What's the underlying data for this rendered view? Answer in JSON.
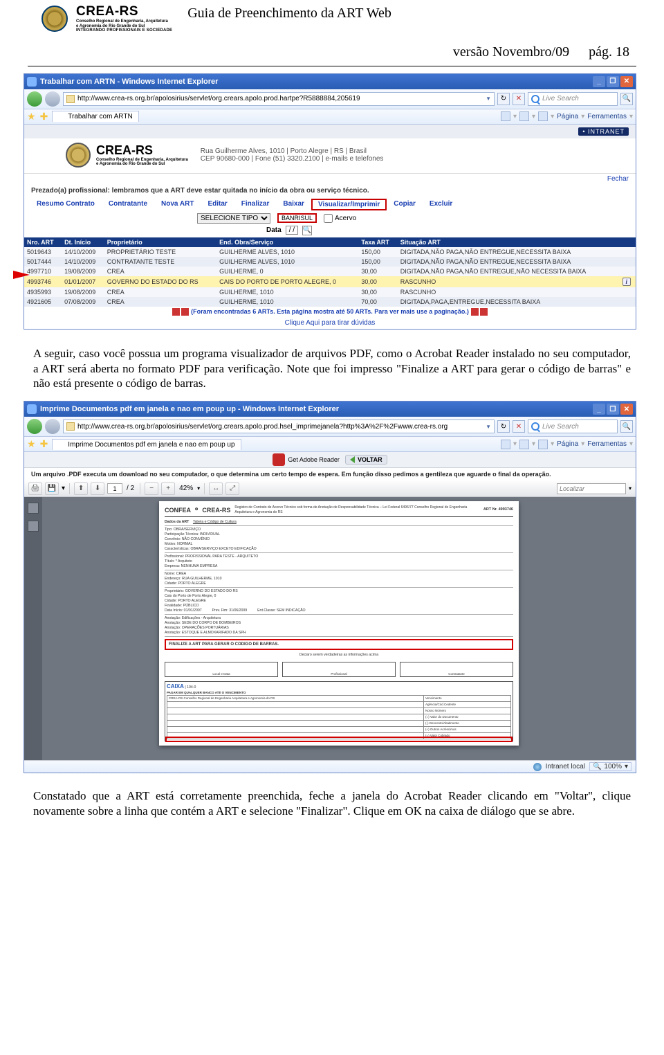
{
  "header": {
    "logo_main": "CREA-RS",
    "logo_sub1": "Conselho Regional de Engenharia, Arquitetura",
    "logo_sub2": "e Agronomia do Rio Grande do Sul",
    "logo_sub3": "INTEGRANDO PROFISSIONAIS E SOCIEDADE",
    "title": "Guia de Preenchimento da ART Web",
    "version": "versão Novembro/09",
    "page": "pág. 18"
  },
  "ie1": {
    "title": "Trabalhar com ARTN - Windows Internet Explorer",
    "url": "http://www.crea-rs.org.br/apolosirius/servlet/org.crears.apolo.prod.hartpe?R5888884,205619",
    "search_placeholder": "Live Search",
    "tab_label": "Trabalhar com ARTN",
    "toolbar_pagina": "Página",
    "toolbar_ferramentas": "Ferramentas",
    "btn_min": "_",
    "btn_max": "❐",
    "btn_close": "✕"
  },
  "app": {
    "intranet": "• INTRANET",
    "logo": "CREA-RS",
    "logo_sub": "Conselho Regional de Engenharia, Arquitetura\ne Agronomia do Rio Grande do Sul",
    "address1": "Rua Guilherme Alves, 1010 | Porto Alegre | RS | Brasil",
    "address2": "CEP 90680-000 | Fone (51) 3320.2100 | e-mails e telefones",
    "fechar": "Fechar",
    "notice": "Prezado(a) profissional: lembramos que a ART deve estar quitada no início da obra ou serviço técnico.",
    "menu": [
      "Resumo Contrato",
      "Contratante",
      "Nova ART",
      "Editar",
      "Finalizar",
      "Baixar",
      "Visualizar/Imprimir",
      "Copiar",
      "Excluir"
    ],
    "highlight_menu_index": 6,
    "filter_select": "SELECIONE TIPO",
    "filter_bank": "BANRISUL",
    "filter_acervo": "Acervo",
    "filter_data_label": "Data",
    "filter_date": "/  /",
    "columns": [
      "Nro. ART",
      "Dt. Início",
      "Proprietário",
      "End. Obra/Serviço",
      "Taxa ART",
      "Situação ART"
    ],
    "rows": [
      {
        "nro": "5019643",
        "dt": "14/10/2009",
        "prop": "PROPRIETÁRIO TESTE",
        "end": "GUILHERME ALVES, 1010",
        "taxa": "150,00",
        "sit": "DIGITADA,NÃO PAGA,NÃO ENTREGUE,NECESSITA BAIXA"
      },
      {
        "nro": "5017444",
        "dt": "14/10/2009",
        "prop": "CONTRATANTE TESTE",
        "end": "GUILHERME ALVES, 1010",
        "taxa": "150,00",
        "sit": "DIGITADA,NÃO PAGA,NÃO ENTREGUE,NECESSITA BAIXA"
      },
      {
        "nro": "4997710",
        "dt": "19/08/2009",
        "prop": "CREA",
        "end": "GUILHERME, 0",
        "taxa": "30,00",
        "sit": "DIGITADA,NÃO PAGA,NÃO ENTREGUE,NÃO NECESSITA BAIXA"
      },
      {
        "nro": "4993746",
        "dt": "01/01/2007",
        "prop": "GOVERNO DO ESTADO DO RS",
        "end": "CAIS DO PORTO DE PORTO ALEGRE, 0",
        "taxa": "30,00",
        "sit": "RASCUNHO"
      },
      {
        "nro": "4935993",
        "dt": "19/08/2009",
        "prop": "CREA",
        "end": "GUILHERME, 1010",
        "taxa": "30,00",
        "sit": "RASCUNHO"
      },
      {
        "nro": "4921605",
        "dt": "07/08/2009",
        "prop": "CREA",
        "end": "GUILHERME, 1010",
        "taxa": "70,00",
        "sit": "DIGITADA,PAGA,ENTREGUE,NECESSITA BAIXA"
      }
    ],
    "highlight_row_index": 3,
    "pagination_note": "(Foram encontradas   6 ARTs. Esta página mostra até 50 ARTs. Para ver mais use a paginação.)",
    "help": "Clique Aqui para tirar dúvidas"
  },
  "para1": "A seguir, caso você possua um programa visualizador de arquivos PDF, como o Acrobat Reader instalado no seu computador, a ART será aberta no formato PDF para verificação. Note que foi impresso \"Finalize a ART para gerar o código de barras\" e não está presente o código de barras.",
  "ie2": {
    "title": "Imprime Documentos pdf em janela e nao em poup up - Windows Internet Explorer",
    "url": "http://www.crea-rs.org.br/apolosirius/servlet/org.crears.apolo.prod.hsel_imprimejanela?http%3A%2F%2Fwww.crea-rs.org",
    "search_placeholder": "Live Search",
    "tab_label": "Imprime Documentos pdf em janela e nao em poup up",
    "toolbar_pagina": "Página",
    "toolbar_ferramentas": "Ferramentas",
    "getreader": "Get Adobe Reader",
    "voltar": "VOLTAR",
    "notice": "Um arquivo .PDF executa um download no seu computador, o que determina um certo tempo de espera. Em função disso pedimos a gentileza que aguarde o final da operação.",
    "page_current": "1",
    "page_total": "/ 2",
    "zoom": "42%",
    "find_placeholder": "Localizar",
    "status_zone": "Intranet local",
    "status_zoom": "100%"
  },
  "pdfdoc": {
    "confea": "CONFEA",
    "crears": "CREA-RS",
    "hdr_desc": "Registro de Contrato de Acervo Técnico sob forma de Anotação de Responsabilidade Técnica – Lei Federal 6496/77 Conselho Regional de Engenharia Arquitetura e Agronomia do RS",
    "artno_label": "ART Nr.",
    "artno": "4993746",
    "dados_art": "Dados da ART",
    "tabela_cultura": "Tabela e Código de Cultura",
    "tipo": "Tipo: OBRA/SERVIÇO",
    "part": "Participação Técnica:  INDIVIDUAL",
    "convenio": "Convênio: NÃO CONVÊNIO",
    "motivo": "Motivo: NORMAL",
    "carac": "Características: OBRA/SERVIÇO EXCETO EDIFICAÇÃO",
    "profissional": "Profissional: PROFISSIONAL PARA TESTE - ARQUITETO",
    "titulo": "Título: * Arquiteto",
    "empresa": "Empresa: NENHUMA EMPRESA",
    "contratante": "Nome: CREA",
    "endereco": "Endereço: RUA GUILHERME, 1010",
    "cidade": "Cidade: PORTO ALEGRE",
    "proprietario": "Proprietário: GOVERNO DO ESTADO DO RS",
    "end_obra": "Cais do Porto de Porto Alegre, 0",
    "cidobra": "Cidade: PORTO ALEGRE",
    "finalidade": "Finalidade: PÚBLICO",
    "dtinicio": "Data Início:  01/01/2007",
    "prevfim": "Prev. Fim: 31/06/2009",
    "entclasse": "Ent.Classe: SEM INDICAÇÃO",
    "atividades": [
      "Edificações - Arquitetura",
      "SEDE DO CORPO DE BOMBEIROS",
      "OPERAÇÕES PORTUÁRIAS",
      "ESTOQUE E ALMOXARIFADO DA SPH"
    ],
    "finalize": "FINALIZE A ART PARA GERAR O CODIGO DE BARRAS.",
    "declaro": "Declaro serem verdadeiras as informações acima",
    "sig_local": "Local e Data",
    "sig_prof": "Profissional",
    "sig_contr": "Contratante",
    "caixa": "CAIXA",
    "caixa_code": "104-0",
    "boleto_title": "PAGAR EM QUALQUER BANCO ATÉ O VENCIMENTO",
    "cedente": "CREA-RS Conselho Regional de Engenharia Arquitetura e Agronomia do RS"
  },
  "para2": "Constatado que a ART está corretamente preenchida, feche a janela do Acrobat Reader clicando em \"Voltar\", clique novamente sobre a linha que contém a ART e selecione \"Finalizar\". Clique em OK na caixa de diálogo que se abre."
}
